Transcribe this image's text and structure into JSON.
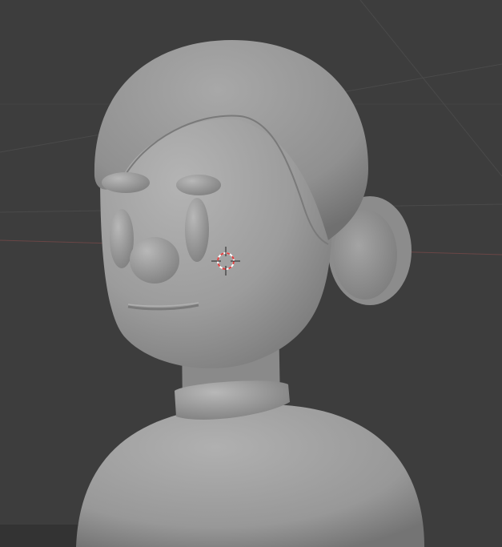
{
  "viewport": {
    "mode": "solid-shading",
    "colors": {
      "background": "#3d3d3d",
      "grid_line": "#4a4a4a",
      "x_axis": "#7a4a4a",
      "model_base": "#9a9a9a",
      "model_light": "#b8b8b8",
      "model_shadow": "#6a6a6a",
      "cursor_red": "#e04040",
      "cursor_white": "#ffffff"
    },
    "icons": [
      "3d-cursor-icon"
    ]
  }
}
